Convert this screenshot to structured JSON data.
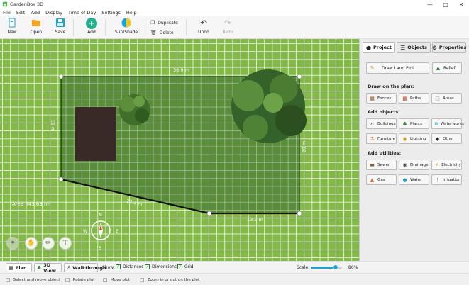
{
  "window": {
    "title": "GardenBox 3D"
  },
  "menu": [
    "File",
    "Edit",
    "Add",
    "Display",
    "Time of Day",
    "Settings",
    "Help"
  ],
  "toolbar": {
    "new": "New",
    "open": "Open",
    "save": "Save",
    "add": "Add",
    "sun_shade": "Sun/Shade",
    "duplicate": "Duplicate",
    "delete": "Delete",
    "undo": "Undo",
    "redo": "Redo"
  },
  "plot": {
    "top_length": "36.9 m",
    "left_length": "15 m",
    "right_length": "20 m",
    "diag_length": "22.3 m",
    "bottom_length": "13.2 m",
    "area": "Area 643.63  m²"
  },
  "compass": {
    "n": "N",
    "s": "S",
    "e": "E",
    "w": "W"
  },
  "panel": {
    "tabs": {
      "project": "Project",
      "objects": "Objects",
      "properties": "Properties"
    },
    "draw_land_plot": "Draw Land Plot",
    "relief": "Relief",
    "draw_on_plan": "Draw on the plan:",
    "fences": "Fences",
    "paths": "Paths",
    "areas": "Areas",
    "add_objects": "Add objects:",
    "buildings": "Buildings",
    "plants": "Plants",
    "waterworks": "Waterworks",
    "furniture": "Furniture",
    "lighting": "Lighting",
    "other": "Other",
    "add_utilities": "Add utilities:",
    "sewer": "Sewer",
    "drainage": "Drainage",
    "electricity": "Electricity",
    "gas": "Gas",
    "water": "Water",
    "irrigation": "Irrigation"
  },
  "views": {
    "plan": "Plan",
    "view3d": "3D View",
    "walkthrough": "Walkthrough"
  },
  "show": {
    "label": "Show:",
    "distances": "Distances",
    "dimensions": "Dimensions",
    "grid": "Grid"
  },
  "scale": {
    "label": "Scale:",
    "value": "80%",
    "level": 0.8
  },
  "status": {
    "select": "Select and move object",
    "rotate": "Rotate plot",
    "move": "Move plot",
    "zoom": "Zoom in or out on the plot"
  },
  "colors": {
    "grass": "#84b94a",
    "accent": "#1aa3d9",
    "add_button": "#21b08a"
  }
}
